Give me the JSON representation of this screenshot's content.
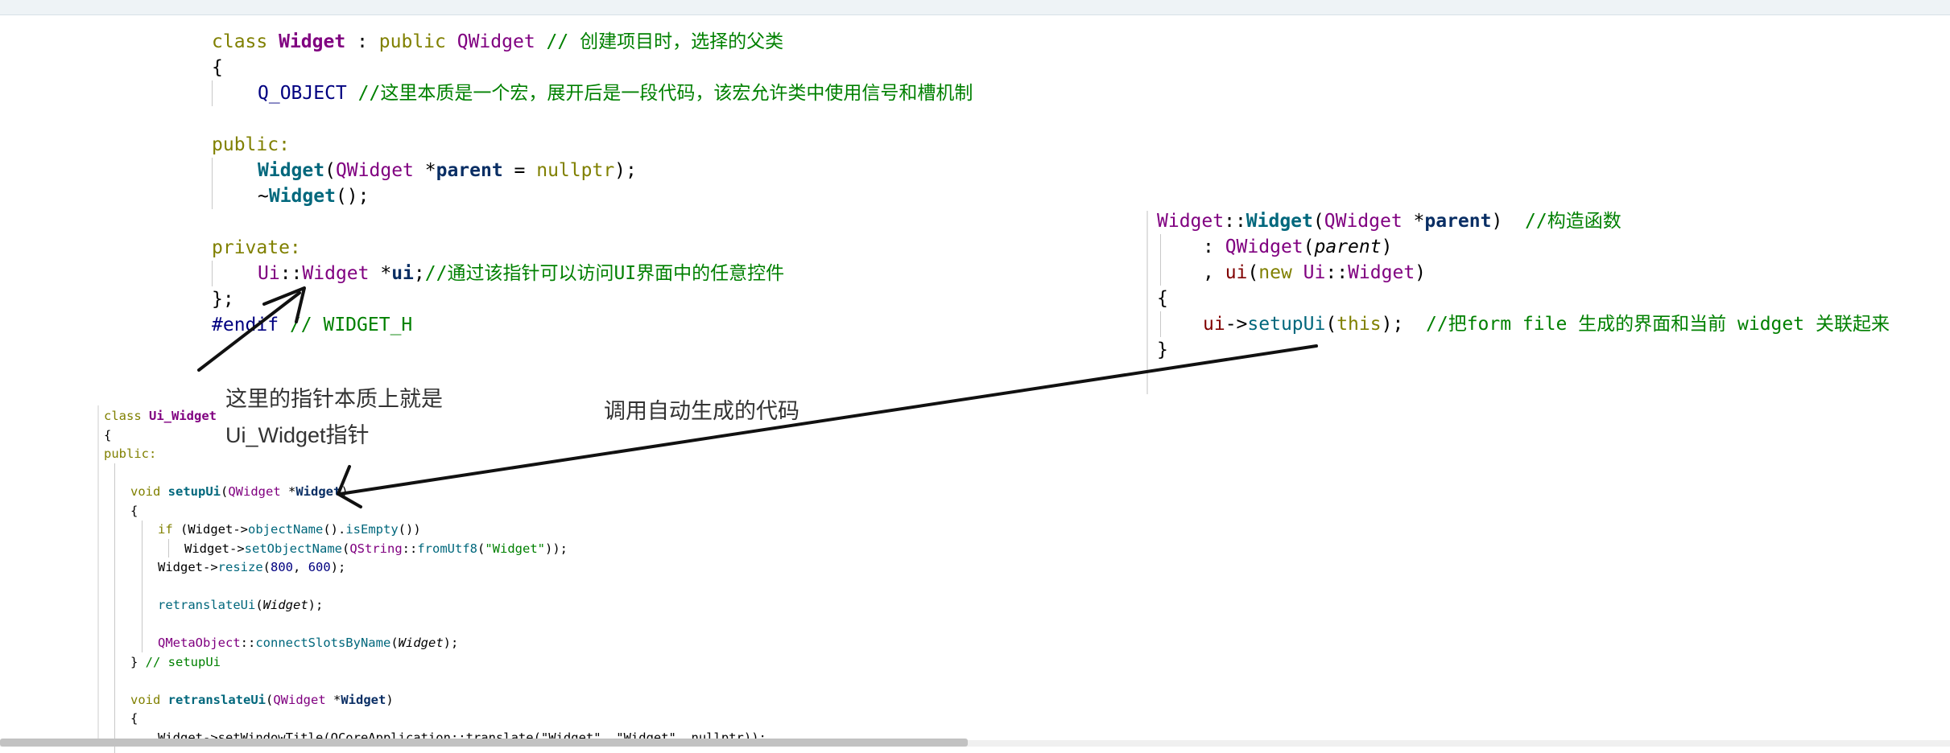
{
  "header_snippet": {
    "class_keyword": "class",
    "class_name": "Widget",
    "colon": ":",
    "public_keyword": "public",
    "base_class": "QWidget",
    "class_comment": "// 创建项目时，选择的父类",
    "open_brace": "{",
    "q_object": "Q_OBJECT",
    "q_object_comment": "//这里本质是一个宏，展开后是一段代码，该宏允许类中使用信号和槽机制",
    "public_label": "public:",
    "ctor_name": "Widget",
    "ctor_params_type": "QWidget",
    "ctor_params_rest": " *",
    "ctor_param_name": "parent",
    "ctor_default": " = ",
    "ctor_nullptr": "nullptr",
    "ctor_end": ");",
    "dtor_tilde": "~",
    "dtor_name": "Widget",
    "dtor_end": "();",
    "private_label": "private:",
    "ui_ns": "Ui",
    "ui_sep": "::",
    "ui_type": "Widget",
    "ui_star": " *",
    "ui_var": "ui",
    "ui_end": ";",
    "ui_comment": "//通过该指针可以访问UI界面中的任意控件",
    "close_brace": "};",
    "endif": "#endif",
    "endif_comment": " // WIDGET_H"
  },
  "ctor_snippet": {
    "cls": "Widget",
    "sep": "::",
    "fn": "Widget",
    "open": "(",
    "param_type": "QWidget",
    "star": " *",
    "param": "parent",
    "close": ")",
    "comment": "//构造函数",
    "init1_prefix": ": ",
    "init1_base": "QWidget",
    "init1_arg": "parent",
    "init2_prefix": ", ",
    "init2_name": "ui",
    "init2_new": "new",
    "init2_ns": "Ui",
    "init2_type": "Widget",
    "brace_open": "{",
    "body_ui": "ui",
    "body_arrow": "->",
    "body_fn": "setupUi",
    "body_this": "this",
    "body_end": ");",
    "body_comment": "//把form file 生成的界面和当前 widget 关联起来",
    "brace_close": "}"
  },
  "generated_snippet": {
    "class_kw": "class",
    "class_name": "Ui_Widget",
    "open": "{",
    "public": "public:",
    "setup_void": "void",
    "setup_name": "setupUi",
    "setup_type": "QWidget",
    "setup_param": "Widget",
    "if_kw": "if",
    "if_obj": "Widget",
    "if_fn": "objectName",
    "if_fn2": "isEmpty",
    "set_obj": "Widget",
    "set_fn": "setObjectName",
    "qstring": "QString",
    "from_utf8": "fromUtf8",
    "name_str": "\"Widget\"",
    "resize_obj": "Widget",
    "resize_fn": "resize",
    "w": "800",
    "h": "600",
    "retrans_call": "retranslateUi",
    "retrans_arg": "Widget",
    "qmeta": "QMetaObject",
    "connect_fn": "connectSlotsByName",
    "connect_arg": "Widget",
    "close_setup": "} // setupUi",
    "retrans_void": "void",
    "retrans_name": "retranslateUi",
    "retrans_type": "QWidget",
    "retrans_param": "Widget",
    "open2": "{",
    "last_line": "Widget->setWindowTitle(QCoreApplication::translate(\"Widget\", \"Widget\", nullptr));"
  },
  "annotations": {
    "pointer_note_line1": "这里的指针本质上就是",
    "pointer_note_line2": "Ui_Widget指针",
    "call_note": "调用自动生成的代码"
  }
}
